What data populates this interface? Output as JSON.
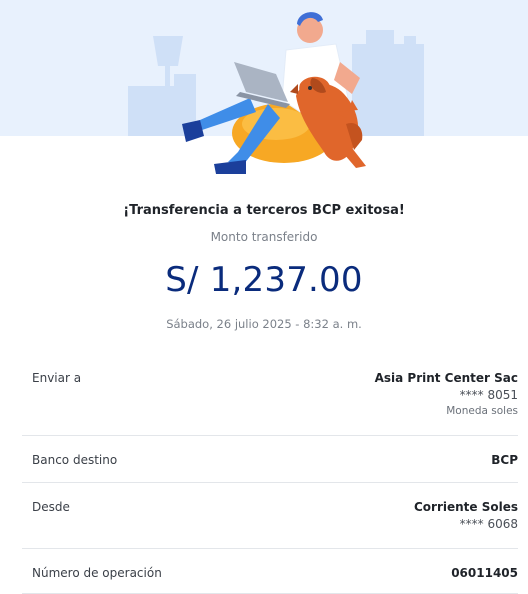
{
  "header": {
    "title": "¡Transferencia a terceros BCP exitosa!",
    "subtitle": "Monto transferido",
    "amount": "S/ 1,237.00",
    "datetime": "Sábado, 26 julio 2025 - 8:32 a. m."
  },
  "details": {
    "send_to": {
      "label": "Enviar a",
      "name": "Asia Print Center Sac",
      "account": "**** 8051",
      "currency": "Moneda soles"
    },
    "bank": {
      "label": "Banco destino",
      "value": "BCP"
    },
    "from": {
      "label": "Desde",
      "account_type": "Corriente Soles",
      "account": "**** 6068"
    },
    "operation": {
      "label": "Número de operación",
      "value": "06011405"
    }
  },
  "colors": {
    "amount": "#0a2b7c",
    "hero_background": "#e8f1fd",
    "illustration_orange": "#f7a824",
    "illustration_blue": "#3f8de8"
  }
}
